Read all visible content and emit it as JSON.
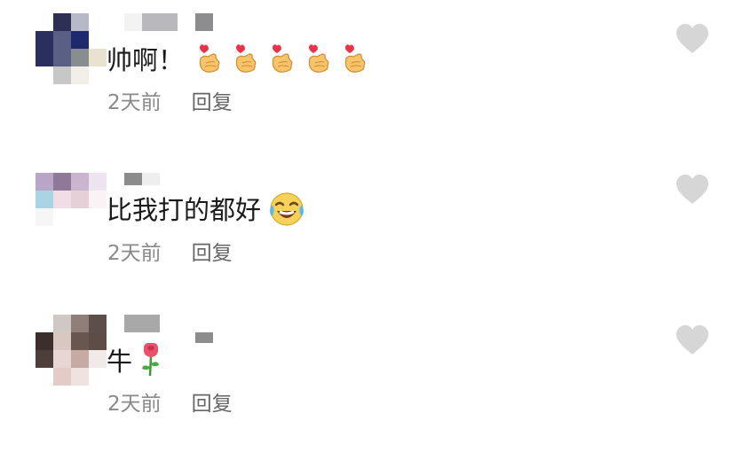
{
  "comments": [
    {
      "text": "帅啊！",
      "emoji": "finger-heart-emoji",
      "emoji_count": 5,
      "time": "2天前",
      "reply_label": "回复",
      "like_icon": "heart-icon"
    },
    {
      "text": "比我打的都好",
      "emoji": "laughing-crying-emoji",
      "time": "2天前",
      "reply_label": "回复",
      "like_icon": "heart-icon"
    },
    {
      "text": "牛",
      "emoji": "rose-emoji",
      "time": "2天前",
      "reply_label": "回复",
      "like_icon": "heart-icon"
    }
  ],
  "colors": {
    "text": "#1a1a1a",
    "meta": "#8a8a8a",
    "like_icon": "#d6d6d6"
  }
}
